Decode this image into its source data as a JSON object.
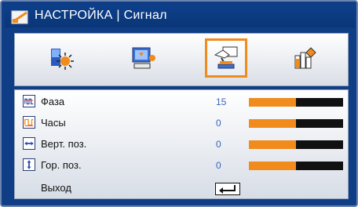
{
  "title": "НАСТРОЙКА | Сигнал",
  "colors": {
    "accent": "#f08b1c",
    "frame": "#0f3e86",
    "value": "#3a64b8"
  },
  "tabs": [
    {
      "icon": "image-settings-icon",
      "selected": false
    },
    {
      "icon": "display-settings-icon",
      "selected": false
    },
    {
      "icon": "setup-settings-icon",
      "selected": true
    },
    {
      "icon": "options-settings-icon",
      "selected": false
    }
  ],
  "items": [
    {
      "label": "Фаза",
      "value": "15",
      "icon": "phase-icon",
      "level": 0.5
    },
    {
      "label": "Часы",
      "value": "0",
      "icon": "clock-icon",
      "level": 0.5
    },
    {
      "label": "Верт. поз.",
      "value": "0",
      "icon": "vertical-position-icon",
      "level": 0.5
    },
    {
      "label": "Гор. поз.",
      "value": "0",
      "icon": "horizontal-position-icon",
      "level": 0.5
    }
  ],
  "exit": {
    "label": "Выход",
    "icon": "enter-return-icon"
  }
}
